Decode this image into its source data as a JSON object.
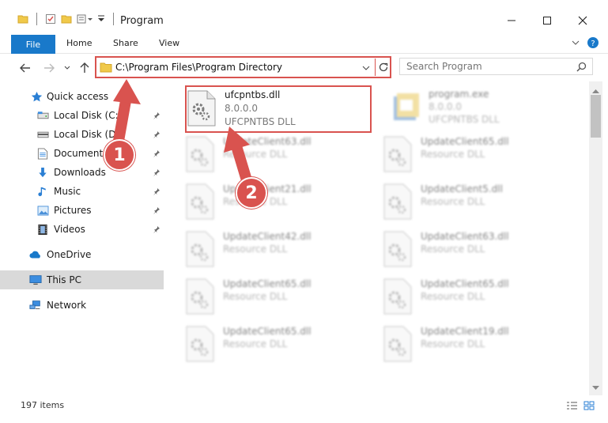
{
  "window": {
    "title": "Program"
  },
  "ribbon": {
    "file_label": "File",
    "home_label": "Home",
    "share_label": "Share",
    "view_label": "View"
  },
  "address": {
    "path": "C:\\Program Files\\Program Directory"
  },
  "search": {
    "placeholder": "Search Program"
  },
  "sidebar": {
    "items": [
      {
        "label": "Quick access",
        "icon": "star-icon"
      },
      {
        "label": "Local Disk (C:)",
        "icon": "drive-icon"
      },
      {
        "label": "Local Disk (D:)",
        "icon": "drive-icon"
      },
      {
        "label": "Documents",
        "icon": "documents-icon"
      },
      {
        "label": "Downloads",
        "icon": "download-icon"
      },
      {
        "label": "Music",
        "icon": "music-icon"
      },
      {
        "label": "Pictures",
        "icon": "pictures-icon"
      },
      {
        "label": "Videos",
        "icon": "videos-icon"
      },
      {
        "label": "OneDrive",
        "icon": "cloud-icon"
      },
      {
        "label": "This PC",
        "icon": "computer-icon"
      },
      {
        "label": "Network",
        "icon": "network-icon"
      }
    ]
  },
  "files": [
    {
      "name": "ufcpntbs.dll",
      "version": "8.0.0.0",
      "desc": "UFCPNTBS DLL"
    },
    {
      "name": "program.exe",
      "version": "8.0.0.0",
      "desc": "UFCPNTBS DLL"
    },
    {
      "name": "UpdateClient63.dll",
      "version": "",
      "desc": "Resource DLL"
    },
    {
      "name": "UpdateClient65.dll",
      "version": "",
      "desc": "Resource DLL"
    },
    {
      "name": "UpdateClient21.dll",
      "version": "",
      "desc": "Resource DLL"
    },
    {
      "name": "UpdateClient5.dll",
      "version": "",
      "desc": "Resource DLL"
    },
    {
      "name": "UpdateClient42.dll",
      "version": "",
      "desc": "Resource DLL"
    },
    {
      "name": "UpdateClient63.dll",
      "version": "",
      "desc": "Resource DLL"
    },
    {
      "name": "UpdateClient65.dll",
      "version": "",
      "desc": "Resource DLL"
    },
    {
      "name": "UpdateClient65.dll",
      "version": "",
      "desc": "Resource DLL"
    },
    {
      "name": "UpdateClient65.dll",
      "version": "",
      "desc": "Resource DLL"
    },
    {
      "name": "UpdateClient19.dll",
      "version": "",
      "desc": "Resource DLL"
    }
  ],
  "status": {
    "item_count": "197 items"
  },
  "annotations": {
    "step1": "1",
    "step2": "2"
  },
  "colors": {
    "accent": "#1979ca",
    "annotation": "#d9534f",
    "selected": "#d9d9d9"
  }
}
